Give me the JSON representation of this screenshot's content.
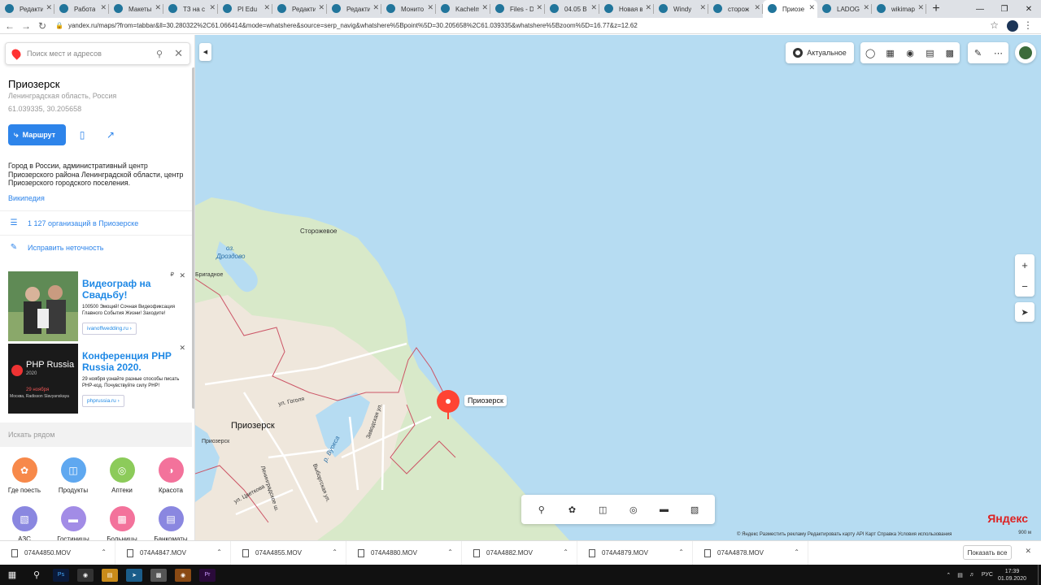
{
  "browser": {
    "tabs": [
      {
        "label": "Редакти"
      },
      {
        "label": "Работа"
      },
      {
        "label": "Макеты"
      },
      {
        "label": "ТЗ на с"
      },
      {
        "label": "PI Edu"
      },
      {
        "label": "Редакти"
      },
      {
        "label": "Редакти"
      },
      {
        "label": "Монито"
      },
      {
        "label": "Kachelm"
      },
      {
        "label": "Files - D"
      },
      {
        "label": "04.05 В"
      },
      {
        "label": "Новая вкла"
      },
      {
        "label": "Windy"
      },
      {
        "label": "сторож"
      },
      {
        "label": "Приозе"
      },
      {
        "label": "LADOG"
      },
      {
        "label": "wikimap"
      }
    ],
    "new_tab": "+",
    "url": "yandex.ru/maps/?from=tabbar&ll=30.280322%2C61.066414&mode=whatshere&source=serp_navig&whatshere%5Bpoint%5D=30.205658%2C61.039335&whatshere%5Bzoom%5D=16.77&z=12.62"
  },
  "sidebar": {
    "search_placeholder": "Поиск мест и адресов",
    "place_title": "Приозерск",
    "place_region": "Ленинградская область, Россия",
    "place_coords": "61.039335, 30.205658",
    "route_label": "Маршрут",
    "description": "Город в России, административный центр Приозерского района Ленинградской области, центр Приозерского городского поселения.",
    "wiki_link": "Википедия",
    "orgs_link": "1 127 организаций в Приозерске",
    "fix_link": "Исправить неточность",
    "ads": [
      {
        "title": "Видеограф на Свадьбу!",
        "desc": "100500 Эмоций! Сочная Видеофиксация Главного События Жизни! Заходите!",
        "link": "ivanoffwedding.ru",
        "badge": "₽"
      },
      {
        "title": "Конференция PHP Russia 2020.",
        "desc": "29 ноября узнайте разные способы писать PHP-код. Почувствуйте силу PHP!",
        "link": "phprussia.ru",
        "img_text": "PHP Russia",
        "img_year": "2020",
        "img_date": "29 ноября",
        "img_venue": "Москва, Radisson Slavyanskaya"
      }
    ],
    "nearby_header": "Искать рядом",
    "nearby": [
      {
        "label": "Где поесть",
        "color": "#f7894a"
      },
      {
        "label": "Продукты",
        "color": "#5fa8f0"
      },
      {
        "label": "Аптеки",
        "color": "#8ccb5a"
      },
      {
        "label": "Красота",
        "color": "#f3729b"
      },
      {
        "label": "АЗС",
        "color": "#8a87e0"
      },
      {
        "label": "Гостиницы",
        "color": "#a28ce6"
      },
      {
        "label": "Больницы",
        "color": "#f3729b"
      },
      {
        "label": "Банкоматы",
        "color": "#8a87e0"
      }
    ]
  },
  "map": {
    "actual_label": "Актуальное",
    "labels": {
      "storozhevoe": "Сторожевое",
      "lake_oz": "оз.",
      "lake_name": "Дроздово",
      "brigadnoe": "Бригадное",
      "city": "Приозерск",
      "city_small": "Приозерск",
      "street_gogol": "ул. Гоголя",
      "street_leningrad": "Ленинградское ш.",
      "street_tsvetkova": "ул. Цветкова",
      "street_vyborgskaya": "Выборгская ул.",
      "river_vuoksa": "р. Вуокса",
      "street_zavodskaya": "Заводская ул.",
      "pin_label": "Приозерск"
    },
    "brand": "Яндекс",
    "copyright": "© Яндекс   Разместить рекламу   Редактировать карту   API Карт   Справка   Условия использования",
    "scale": "900 м",
    "zoom_in": "+",
    "zoom_out": "−"
  },
  "downloads": {
    "files": [
      "074A4850.MOV",
      "074A4847.MOV",
      "074A4855.MOV",
      "074A4880.MOV",
      "074A4882.MOV",
      "074A4879.MOV",
      "074A4878.MOV"
    ],
    "show_all": "Показать все"
  },
  "taskbar": {
    "lang": "РУС",
    "time": "17:39",
    "date": "01.09.2020"
  }
}
